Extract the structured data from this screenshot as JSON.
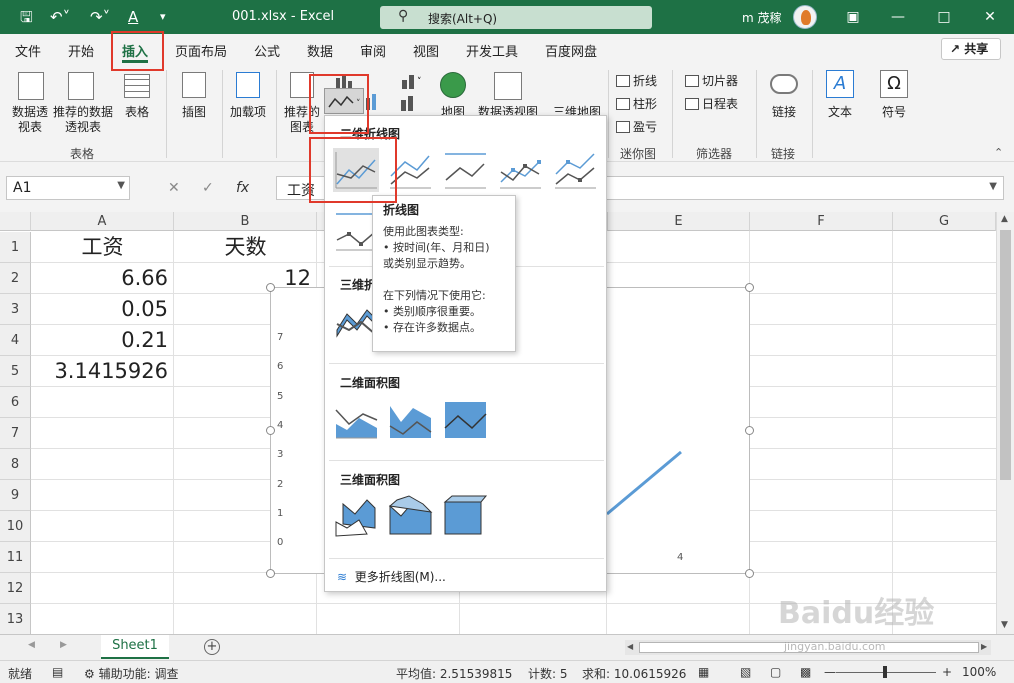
{
  "titlebar": {
    "filename": "001.xlsx",
    "sep": "-",
    "app": "Excel",
    "search_placeholder": "搜索(Alt+Q)",
    "user": "m 茂稼"
  },
  "tabs": [
    "文件",
    "开始",
    "插入",
    "页面布局",
    "公式",
    "数据",
    "审阅",
    "视图",
    "开发工具",
    "百度网盘"
  ],
  "active_tab": "插入",
  "share_label": "共享",
  "ribbon": {
    "pivot_table": "数据透视表",
    "recommended_pivot": "推荐的数据透视表",
    "table": "表格",
    "group_tables": "表格",
    "illustrations": "插图",
    "addins": "加载项",
    "recommended_charts": "推荐的图表",
    "maps": "地图",
    "pivot_chart": "数据透视图",
    "map3d": "三维地图",
    "spark_line": "折线",
    "spark_column": "柱形",
    "spark_winloss": "盈亏",
    "group_sparklines": "迷你图",
    "slicer": "切片器",
    "timeline": "日程表",
    "group_filters": "筛选器",
    "link": "链接",
    "group_links": "链接",
    "text": "文本",
    "symbols": "符号"
  },
  "namebox": "A1",
  "formula": "工资",
  "columns": [
    "A",
    "B",
    "E",
    "F",
    "G"
  ],
  "rows": [
    "1",
    "2",
    "3",
    "4",
    "5",
    "6",
    "7",
    "8",
    "9",
    "10",
    "11",
    "12",
    "13"
  ],
  "cells": {
    "a1": "工资",
    "b1": "天数",
    "a2": "6.66",
    "b2_partial": "12",
    "a3": "0.05",
    "a4": "0.21",
    "a5": "3.1415926"
  },
  "chart": {
    "y_ticks": [
      "7",
      "6",
      "5",
      "4",
      "3",
      "2",
      "1",
      "0"
    ],
    "x_tick": "4",
    "line_color": "#5b9bd5"
  },
  "dropdown": {
    "sections": [
      "二维折线图",
      "三维折线图",
      "二维面积图",
      "三维面积图"
    ],
    "more": "更多折线图(M)..."
  },
  "tooltip": {
    "title": "折线图",
    "lines": [
      "使用此图表类型:",
      "• 按时间(年、月和日)",
      "或类别显示趋势。",
      "",
      "在下列情况下使用它:",
      "• 类别顺序很重要。",
      "• 存在许多数据点。"
    ]
  },
  "sheet_tab": "Sheet1",
  "status": {
    "ready": "就绪",
    "accessibility": "辅助功能: 调查",
    "average": "平均值: 2.51539815",
    "count": "计数: 5",
    "sum": "求和: 10.0615926",
    "zoom": "100%"
  },
  "watermark": "Baidu经验",
  "watermark_sub": "jingyan.baidu.com",
  "colors": {
    "excel_green": "#1e7145",
    "highlight_red": "#e0392b",
    "chart_blue": "#5b9bd5"
  }
}
